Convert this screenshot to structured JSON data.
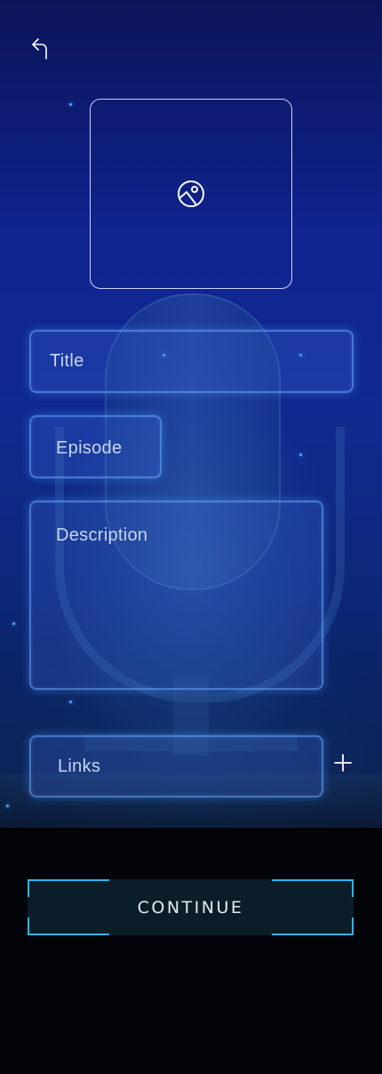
{
  "colors": {
    "accent": "#29b7f0",
    "field_border": "#6eaaff",
    "background_bottom": "#030409",
    "hero_blue": "#102a91"
  },
  "header": {
    "back_icon": "back-arrow-icon"
  },
  "cover": {
    "icon": "image-placeholder-icon"
  },
  "form": {
    "title_placeholder": "Title",
    "episode_placeholder": "Episode",
    "description_placeholder": "Description",
    "links_placeholder": "Links",
    "add_link_icon": "plus-icon"
  },
  "footer": {
    "continue_label": "CONTINUE"
  }
}
